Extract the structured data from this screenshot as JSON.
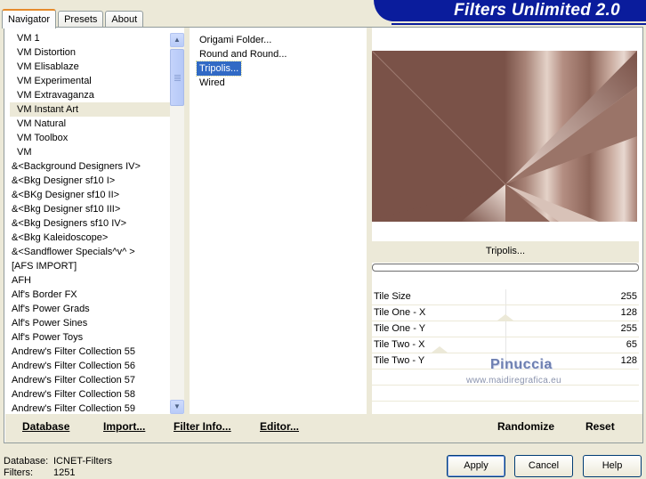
{
  "tabs": [
    "Navigator",
    "Presets",
    "About"
  ],
  "banner_title": "Filters Unlimited 2.0",
  "categories": [
    "VM 1",
    "VM Distortion",
    "VM Elisablaze",
    "VM Experimental",
    "VM Extravaganza",
    "VM Instant Art",
    "VM Natural",
    "VM Toolbox",
    "VM",
    "&<Background Designers IV>",
    "&<Bkg Designer sf10 I>",
    "&<BKg Designer sf10 II>",
    "&<Bkg Designer sf10 III>",
    "&<Bkg Designers sf10 IV>",
    "&<Bkg Kaleidoscope>",
    "&<Sandflower Specials^v^ >",
    "[AFS IMPORT]",
    "AFH",
    "Alf's Border FX",
    "Alf's Power Grads",
    "Alf's Power Sines",
    "Alf's Power Toys",
    "Andrew's Filter Collection 55",
    "Andrew's Filter Collection 56",
    "Andrew's Filter Collection 57",
    "Andrew's Filter Collection 58",
    "Andrew's Filter Collection 59"
  ],
  "selected_category": "VM Instant Art",
  "filters": [
    "Origami Folder...",
    "Round and Round...",
    "Tripolis...",
    "Wired"
  ],
  "selected_filter": "Tripolis...",
  "current_filter_name": "Tripolis...",
  "params": [
    {
      "label": "Tile Size",
      "value": "255"
    },
    {
      "label": "Tile One - X",
      "value": "128"
    },
    {
      "label": "Tile One - Y",
      "value": "255"
    },
    {
      "label": "Tile Two - X",
      "value": "65"
    },
    {
      "label": "Tile Two - Y",
      "value": "128"
    }
  ],
  "watermark": {
    "name": "Pinuccia",
    "url": "www.maidiregrafica.eu"
  },
  "toolbar": {
    "database": "Database",
    "import": "Import...",
    "filter_info": "Filter Info...",
    "editor": "Editor...",
    "randomize": "Randomize",
    "reset": "Reset"
  },
  "status": {
    "database_label": "Database:",
    "database_value": "ICNET-Filters",
    "filters_label": "Filters:",
    "filters_value": "1251"
  },
  "buttons": {
    "apply": "Apply",
    "cancel": "Cancel",
    "help": "Help"
  },
  "colors": {
    "accent_blue": "#0a1c9c",
    "selection": "#316ac5",
    "preview_brown": "#7a5248"
  }
}
